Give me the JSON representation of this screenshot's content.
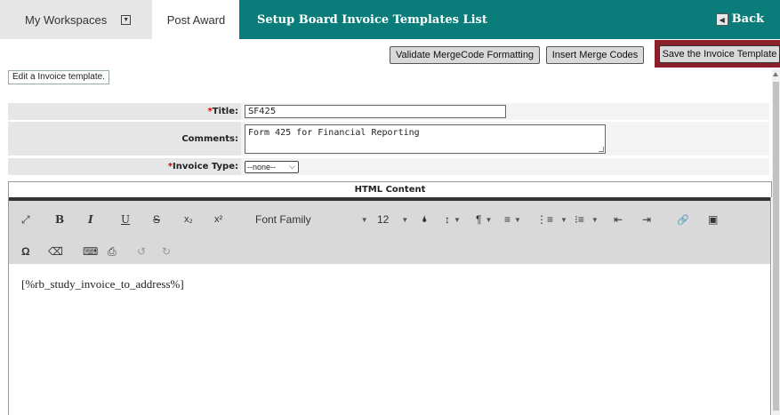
{
  "nav": {
    "workspaces_label": "My Workspaces",
    "workspaces_dropdown_glyph": "▼",
    "post_award_label": "Post Award",
    "page_title": "Setup Board Invoice Templates List",
    "back_label": "Back",
    "back_glyph": "◀"
  },
  "actions": {
    "validate_label": "Validate MergeCode Formatting",
    "insert_label": "Insert Merge Codes",
    "save_label": "Save the Invoice Template"
  },
  "hint_text": "Edit a Invoice template.",
  "form": {
    "required_mark": "*",
    "title_label": "Title:",
    "title_value": "SF425",
    "comments_label": "Comments:",
    "comments_value": "Form 425 for Financial Reporting",
    "invoice_type_label": "Invoice Type:",
    "invoice_type_value": "--none--",
    "invoice_type_arrow": "⌵"
  },
  "editor": {
    "section_title": "HTML Content",
    "font_family_label": "Font Family",
    "font_size_value": "12",
    "content_text": "[%rb_study_invoice_to_address%]",
    "icons": {
      "expand": "⤢",
      "bold": "B",
      "italic": "I",
      "underline": "U",
      "strike": "S",
      "subscript": "x₂",
      "superscript": "x²",
      "caret": "▼",
      "color": "🌢",
      "line_height": "↕",
      "paragraph": "¶",
      "align": "≡",
      "ordered_list": "⋮≡",
      "bullet_list": "⁝≡",
      "outdent": "⇤",
      "indent": "⇥",
      "link": "🔗",
      "image": "▣",
      "special_char": "Ω",
      "eraser": "⌫",
      "keyboard": "⌨",
      "print": "⎙",
      "undo": "↺",
      "redo": "↻"
    }
  },
  "colors": {
    "teal_bar": "#0a7d7a",
    "save_highlight": "#8c1f2c",
    "required": "#cc0000"
  }
}
